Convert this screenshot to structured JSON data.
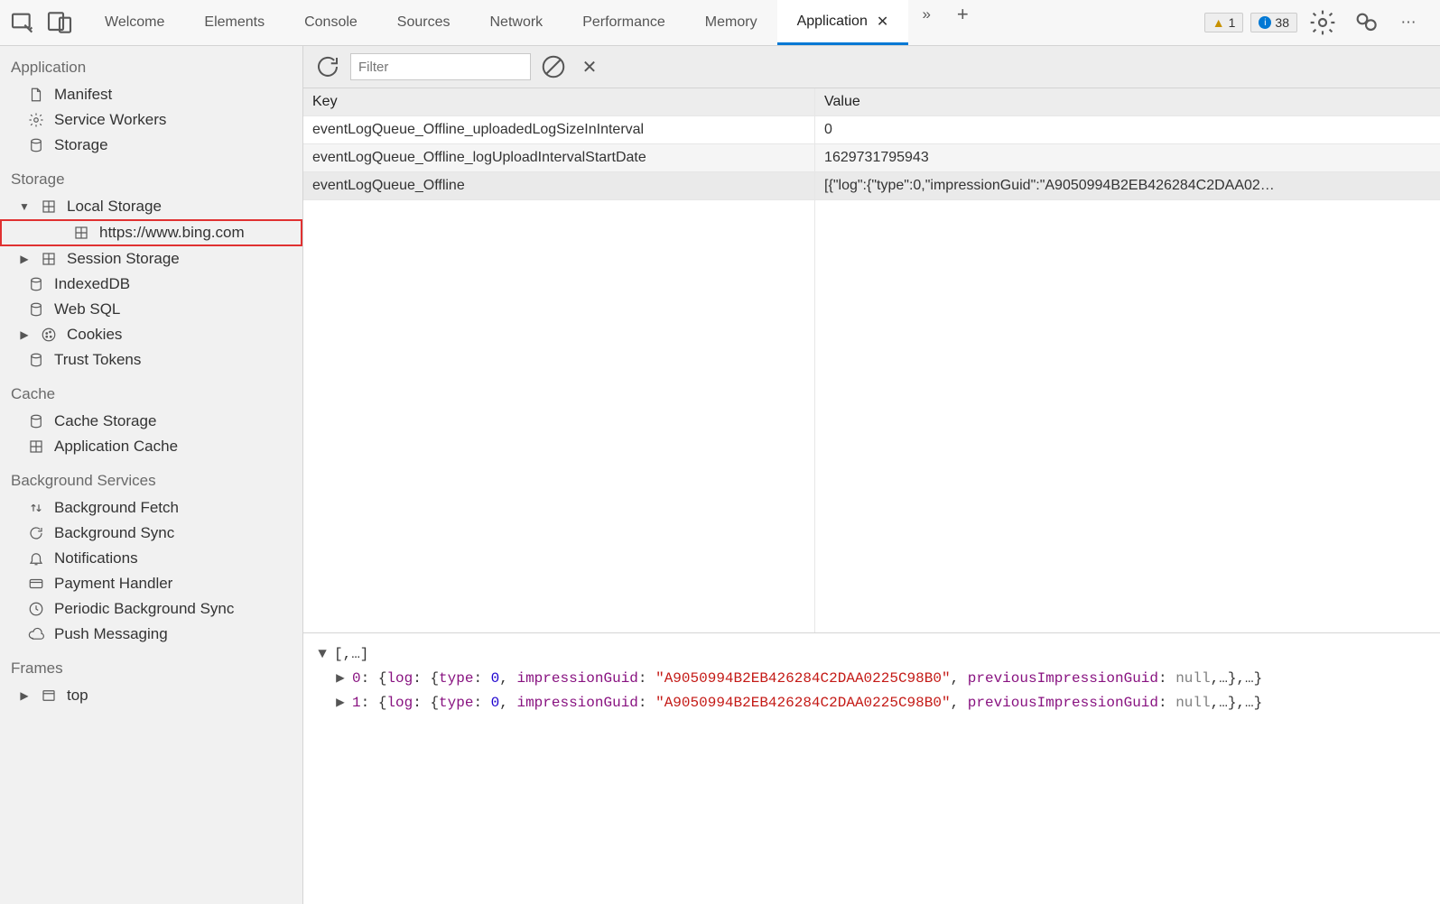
{
  "topbar": {
    "tabs": [
      {
        "label": "Welcome"
      },
      {
        "label": "Elements"
      },
      {
        "label": "Console"
      },
      {
        "label": "Sources"
      },
      {
        "label": "Network"
      },
      {
        "label": "Performance"
      },
      {
        "label": "Memory"
      },
      {
        "label": "Application",
        "active": true
      }
    ],
    "warnings_count": "1",
    "errors_count": "38"
  },
  "sidebar": {
    "sections": {
      "application": {
        "title": "Application",
        "items": [
          {
            "label": "Manifest",
            "icon": "file"
          },
          {
            "label": "Service Workers",
            "icon": "gear"
          },
          {
            "label": "Storage",
            "icon": "cylinder"
          }
        ]
      },
      "storage": {
        "title": "Storage",
        "items": [
          {
            "label": "Local Storage",
            "icon": "grid",
            "expandable": true,
            "expanded": true,
            "children": [
              {
                "label": "https://www.bing.com",
                "icon": "grid",
                "highlighted": true
              }
            ]
          },
          {
            "label": "Session Storage",
            "icon": "grid",
            "expandable": true
          },
          {
            "label": "IndexedDB",
            "icon": "cylinder"
          },
          {
            "label": "Web SQL",
            "icon": "cylinder"
          },
          {
            "label": "Cookies",
            "icon": "cookie",
            "expandable": true
          },
          {
            "label": "Trust Tokens",
            "icon": "cylinder"
          }
        ]
      },
      "cache": {
        "title": "Cache",
        "items": [
          {
            "label": "Cache Storage",
            "icon": "cylinder"
          },
          {
            "label": "Application Cache",
            "icon": "grid"
          }
        ]
      },
      "background": {
        "title": "Background Services",
        "items": [
          {
            "label": "Background Fetch",
            "icon": "updown"
          },
          {
            "label": "Background Sync",
            "icon": "refresh"
          },
          {
            "label": "Notifications",
            "icon": "bell"
          },
          {
            "label": "Payment Handler",
            "icon": "card"
          },
          {
            "label": "Periodic Background Sync",
            "icon": "clock"
          },
          {
            "label": "Push Messaging",
            "icon": "cloud"
          }
        ]
      },
      "frames": {
        "title": "Frames",
        "items": [
          {
            "label": "top",
            "icon": "window",
            "expandable": true
          }
        ]
      }
    }
  },
  "toolbar": {
    "filter_placeholder": "Filter"
  },
  "table": {
    "headers": {
      "key": "Key",
      "value": "Value"
    },
    "rows": [
      {
        "key": "eventLogQueue_Offline_uploadedLogSizeInInterval",
        "value": "0"
      },
      {
        "key": "eventLogQueue_Offline_logUploadIntervalStartDate",
        "value": "1629731795943"
      },
      {
        "key": "eventLogQueue_Offline",
        "value": "[{\"log\":{\"type\":0,\"impressionGuid\":\"A9050994B2EB426284C2DAA02…"
      }
    ]
  },
  "preview": {
    "root": "[,…]",
    "items": [
      {
        "index": "0",
        "guid": "A9050994B2EB426284C2DAA0225C98B0"
      },
      {
        "index": "1",
        "guid": "A9050994B2EB426284C2DAA0225C98B0"
      }
    ],
    "labels": {
      "log": "log",
      "type": "type",
      "type_val": "0",
      "impressionGuid": "impressionGuid",
      "previousImpressionGuid": "previousImpressionGuid",
      "null": "null"
    }
  }
}
